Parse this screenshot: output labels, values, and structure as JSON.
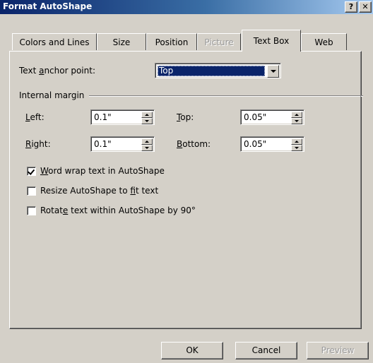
{
  "window": {
    "title": "Format AutoShape",
    "help_label": "?",
    "close_label": "✕"
  },
  "tabs": [
    {
      "label": "Colors and Lines",
      "enabled": true,
      "active": false
    },
    {
      "label": "Size",
      "enabled": true,
      "active": false
    },
    {
      "label": "Position",
      "enabled": true,
      "active": false
    },
    {
      "label": "Picture",
      "enabled": false,
      "active": false
    },
    {
      "label": "Text Box",
      "enabled": true,
      "active": true
    },
    {
      "label": "Web",
      "enabled": true,
      "active": false
    }
  ],
  "anchor": {
    "label_pre": "Text ",
    "label_key": "a",
    "label_post": "nchor point:",
    "value": "Top"
  },
  "margin": {
    "group_label": "Internal margin",
    "left": {
      "key": "L",
      "rest": "eft:",
      "value": "0.1\""
    },
    "right": {
      "key": "R",
      "rest": "ight:",
      "value": "0.1\""
    },
    "top": {
      "key": "T",
      "rest": "op:",
      "value": "0.05\""
    },
    "bottom": {
      "key": "B",
      "rest": "ottom:",
      "value": "0.05\""
    }
  },
  "options": {
    "word_wrap": {
      "pre": "",
      "key": "W",
      "post": "ord wrap text in AutoShape",
      "checked": true
    },
    "resize": {
      "pre": "Resize AutoShape to ",
      "key": "f",
      "post": "it text",
      "checked": false
    },
    "rotate": {
      "pre": "Rotat",
      "key": "e",
      "post": " text within AutoShape by 90°",
      "checked": false
    }
  },
  "buttons": {
    "ok": "OK",
    "cancel": "Cancel",
    "preview": "Preview"
  }
}
